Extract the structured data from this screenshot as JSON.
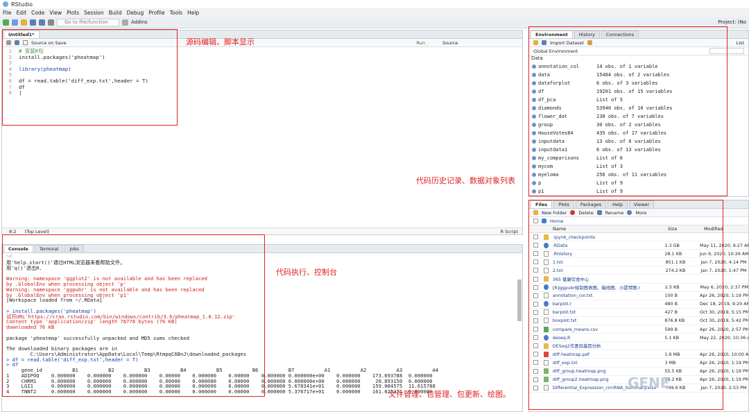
{
  "app": {
    "title": "RStudio",
    "project": "Project: (No"
  },
  "menu": [
    "File",
    "Edit",
    "Code",
    "View",
    "Plots",
    "Session",
    "Build",
    "Debug",
    "Profile",
    "Tools",
    "Help"
  ],
  "toolbar": {
    "goto": "Go to file/function",
    "addins": "Addins"
  },
  "editor": {
    "tab": "Untitled1*",
    "source_on_save": "Source on Save",
    "run": "Run",
    "source": "Source",
    "lines": [
      "# 安装R包",
      "install.packages('pheatmap')",
      "",
      "library(pheatmap)",
      "",
      "df = read.table('diff_exp.txt',header = T)",
      "df",
      "|"
    ],
    "status_pos": "8:2",
    "status_level": "(Top Level)",
    "status_type": "R Script"
  },
  "console": {
    "tabs": [
      "Console",
      "Terminal",
      "Jobs"
    ],
    "path": "~/",
    "lines": [
      {
        "t": "用'help.start()'通过HTML浏览器来看帮助文件。",
        "c": ""
      },
      {
        "t": "用'q()'退出R.",
        "c": ""
      },
      {
        "t": "",
        "c": ""
      },
      {
        "t": "Warning: namespace 'ggplot2' is not available and has been replaced",
        "c": "err"
      },
      {
        "t": "by .GlobalEnv when processing object 'p'",
        "c": "err"
      },
      {
        "t": "Warning: namespace 'ggpubr' is not available and has been replaced",
        "c": "err"
      },
      {
        "t": "by .GlobalEnv when processing object 'p1'",
        "c": "err"
      },
      {
        "t": "[Workspace loaded from ~/.RData]",
        "c": ""
      },
      {
        "t": "",
        "c": ""
      },
      {
        "t": "> install.packages('pheatmap')",
        "c": "blue"
      },
      {
        "t": "试开URL'https://cran.rstudio.com/bin/windows/contrib/3.6/pheatmap_1.0.12.zip'",
        "c": "err"
      },
      {
        "t": "Content type 'application/zip' length 78778 bytes (76 KB)",
        "c": "err"
      },
      {
        "t": "downloaded 76 KB",
        "c": "err"
      },
      {
        "t": "",
        "c": ""
      },
      {
        "t": "package 'pheatmap' successfully unpacked and MD5 sums checked",
        "c": ""
      },
      {
        "t": "",
        "c": ""
      },
      {
        "t": "The downloaded binary packages are in",
        "c": ""
      },
      {
        "t": "        C:\\Users\\Administrator\\AppData\\Local\\Temp\\RtmpqC6BnJ\\downloaded_packages",
        "c": ""
      },
      {
        "t": "> df = read.table('diff_exp.txt',header = T)",
        "c": "blue"
      },
      {
        "t": "> df",
        "c": "blue"
      },
      {
        "t": "     gene_id          B1          B2          B3          B4          B5          B6          B7          A1          A2          A3          A4",
        "c": ""
      },
      {
        "t": "1    ADIPOQ    0.000000    0.000000    0.000000    0.00000    0.000000    0.00000    0.000000 0.000000e+00    0.000000    173.693788  0.000000",
        "c": ""
      },
      {
        "t": "2    CHRM1     0.000000    0.000000    0.000000    0.00000    0.000000    0.00000    0.000000 0.000000e+00    0.000000     20.893150  0.000000",
        "c": ""
      },
      {
        "t": "3    LGI1      0.000000    0.000000    0.000000    0.00000    0.000000    0.00000    0.000000 5.678341e+01    0.000000    159.084575  11.615788",
        "c": ""
      },
      {
        "t": "4    TNNT2     0.000000    0.000000    0.000000    0.00000    0.000000    0.00000    0.000000 5.376717e+01    0.000000    161.025371  0.000000",
        "c": ""
      }
    ]
  },
  "env": {
    "tabs": [
      "Environment",
      "History",
      "Connections"
    ],
    "import": "Import Dataset",
    "scope": "Global Environment",
    "list": "List",
    "section": "Data",
    "rows": [
      [
        "annotation_col",
        "14 obs. of 1 variable"
      ],
      [
        "data",
        "15484 obs. of 2 variables"
      ],
      [
        "dataforplot",
        "6 obs. of 3 variables"
      ],
      [
        "df",
        "19201 obs. of 15 variables"
      ],
      [
        "df_pca",
        "List of 5"
      ],
      [
        "diamonds",
        "53940 obs. of 10 variables"
      ],
      [
        "flower_dat",
        "238 obs. of 7 variables"
      ],
      [
        "group",
        "30 obs. of 2 variables"
      ],
      [
        "HouseVotes84",
        "435 obs. of 17 variables"
      ],
      [
        "inputdata",
        "13 obs. of 6 variables"
      ],
      [
        "inputdata1",
        "6 obs. of 13 variables"
      ],
      [
        "my_comparisons",
        "List of 6"
      ],
      [
        "mycom",
        "List of 3"
      ],
      [
        "myeloma",
        "256 obs. of 11 variables"
      ],
      [
        "p",
        "List of 9"
      ],
      [
        "p1",
        "List of 9"
      ]
    ]
  },
  "files": {
    "tabs": [
      "Files",
      "Plots",
      "Packages",
      "Help",
      "Viewer"
    ],
    "new_folder": "New Folder",
    "delete": "Delete",
    "rename": "Rename",
    "more": "More",
    "home": "Home",
    "cols": [
      "Name",
      "Size",
      "Modified"
    ],
    "rows": [
      {
        "i": "folder",
        "n": ".ipynb_checkpoints",
        "s": "",
        "m": ""
      },
      {
        "i": "r",
        "n": ".RData",
        "s": "1.3 GB",
        "m": "May 11, 2020, 9:27 AM"
      },
      {
        "i": "file",
        "n": ".Rhistory",
        "s": "28.1 KB",
        "m": "Jun 9, 2020, 10:26 AM"
      },
      {
        "i": "file",
        "n": "1.txt",
        "s": "851.1 KB",
        "m": "Jan 7, 2020, 4:14 PM"
      },
      {
        "i": "file",
        "n": "2.txt",
        "s": "274.2 KB",
        "m": "Jan 7, 2020, 1:47 PM"
      },
      {
        "i": "folder",
        "n": "365 健康饮食中心",
        "s": "",
        "m": ""
      },
      {
        "i": "r",
        "n": "[R]ggpubr绘制图表图、箱线图、小提琴图.r",
        "s": "2.5 KB",
        "m": "May 6, 2020, 2:37 PM"
      },
      {
        "i": "file",
        "n": "annotation_col.txt",
        "s": "100 B",
        "m": "Apr 26, 2020, 1:19 PM"
      },
      {
        "i": "r",
        "n": "barplot.r",
        "s": "480 B",
        "m": "Dec 18, 2019, 9:20 AM"
      },
      {
        "i": "file",
        "n": "barplot.txt",
        "s": "427 B",
        "m": "Oct 30, 2019, 5:15 PM"
      },
      {
        "i": "file",
        "n": "boxplot.txt",
        "s": "876.8 KB",
        "m": "Oct 30, 2019, 5:42 PM"
      },
      {
        "i": "csv",
        "n": "compare_means.csv",
        "s": "599 B",
        "m": "Apr 26, 2020, 2:57 PM"
      },
      {
        "i": "r",
        "n": "deseq.R",
        "s": "5.1 KB",
        "m": "May 22, 2020, 10:36 AM"
      },
      {
        "i": "folder",
        "n": "DESeq2作差异基因分析",
        "s": "",
        "m": ""
      },
      {
        "i": "pdf",
        "n": "diff.heatmap.pdf",
        "s": "1.6 MB",
        "m": "Apr 26, 2020, 10:00 AM"
      },
      {
        "i": "file",
        "n": "diff_exp.txt",
        "s": "3 MB",
        "m": "Apr 26, 2020, 1:19 PM"
      },
      {
        "i": "png",
        "n": "diff_group.heatmap.png",
        "s": "55.5 KB",
        "m": "Apr 26, 2020, 1:19 PM"
      },
      {
        "i": "png",
        "n": "diff_group2.heatmap.png",
        "s": "56.2 KB",
        "m": "Apr 26, 2020, 1:19 PM"
      },
      {
        "i": "file",
        "n": "Differential_Expression_circRNA_Summary.xlsx",
        "s": "749.6 KB",
        "m": "Jan 7, 2020, 2:53 PM"
      }
    ]
  },
  "annotations": {
    "editor": "源码编辑、脚本显示",
    "env": "代码历史记录、数据对象列表",
    "console": "代码执行、控制台",
    "files": "文件管理、包管理、包更新、绘图。"
  },
  "watermark": "GENE"
}
